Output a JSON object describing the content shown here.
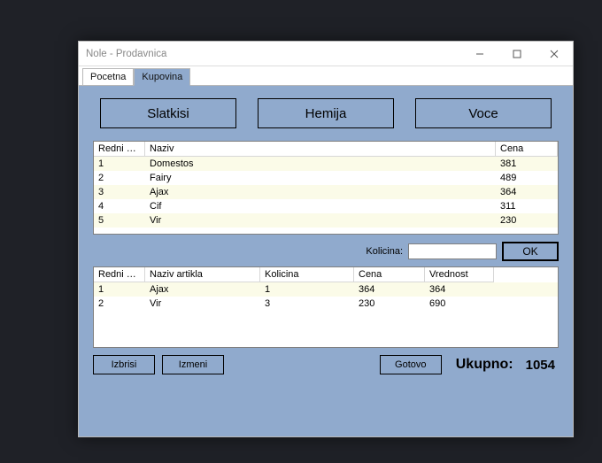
{
  "window": {
    "title": "Nole - Prodavnica"
  },
  "tabs": [
    {
      "label": "Pocetna"
    },
    {
      "label": "Kupovina"
    }
  ],
  "categories": [
    {
      "label": "Slatkisi"
    },
    {
      "label": "Hemija"
    },
    {
      "label": "Voce"
    }
  ],
  "products": {
    "columns": {
      "redni": "Redni broj",
      "naziv": "Naziv",
      "cena": "Cena"
    },
    "rows": [
      {
        "redni": "1",
        "naziv": "Domestos",
        "cena": "381"
      },
      {
        "redni": "2",
        "naziv": "Fairy",
        "cena": "489"
      },
      {
        "redni": "3",
        "naziv": "Ajax",
        "cena": "364"
      },
      {
        "redni": "4",
        "naziv": "Cif",
        "cena": "311"
      },
      {
        "redni": "5",
        "naziv": "Vir",
        "cena": "230"
      }
    ]
  },
  "quantity": {
    "label": "Kolicina:",
    "value": "",
    "ok": "OK"
  },
  "cart": {
    "columns": {
      "redni": "Redni broj",
      "naziv": "Naziv artikla",
      "kolicina": "Kolicina",
      "cena": "Cena",
      "vrednost": "Vrednost"
    },
    "rows": [
      {
        "redni": "1",
        "naziv": "Ajax",
        "kolicina": "1",
        "cena": "364",
        "vrednost": "364"
      },
      {
        "redni": "2",
        "naziv": "Vir",
        "kolicina": "3",
        "cena": "230",
        "vrednost": "690"
      }
    ]
  },
  "footer": {
    "izbrisi": "Izbrisi",
    "izmeni": "Izmeni",
    "gotovo": "Gotovo",
    "ukupno_label": "Ukupno:",
    "ukupno_value": "1054"
  }
}
